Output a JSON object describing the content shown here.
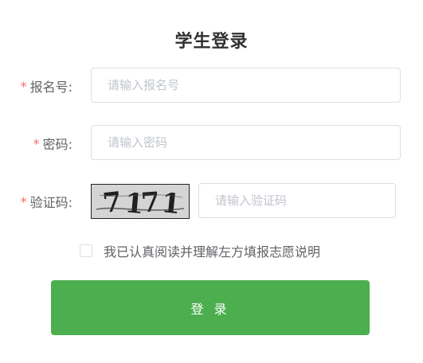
{
  "form": {
    "title": "学生登录",
    "required_mark": "*",
    "fields": [
      {
        "label": "报名号:",
        "placeholder": "请输入报名号",
        "value": ""
      },
      {
        "label": "密码:",
        "placeholder": "请输入密码",
        "value": ""
      },
      {
        "label": "验证码:",
        "placeholder": "请输入验证码",
        "value": ""
      }
    ],
    "captcha": {
      "text": "7171"
    },
    "agreement": {
      "checked": false,
      "label": "我已认真阅读并理解左方填报志愿说明"
    },
    "submit_label": "登 录"
  },
  "colors": {
    "required": "#f56c6c",
    "primary_button": "#4cae4f",
    "input_border": "#dcdfe6",
    "placeholder": "#c0c4cc"
  }
}
